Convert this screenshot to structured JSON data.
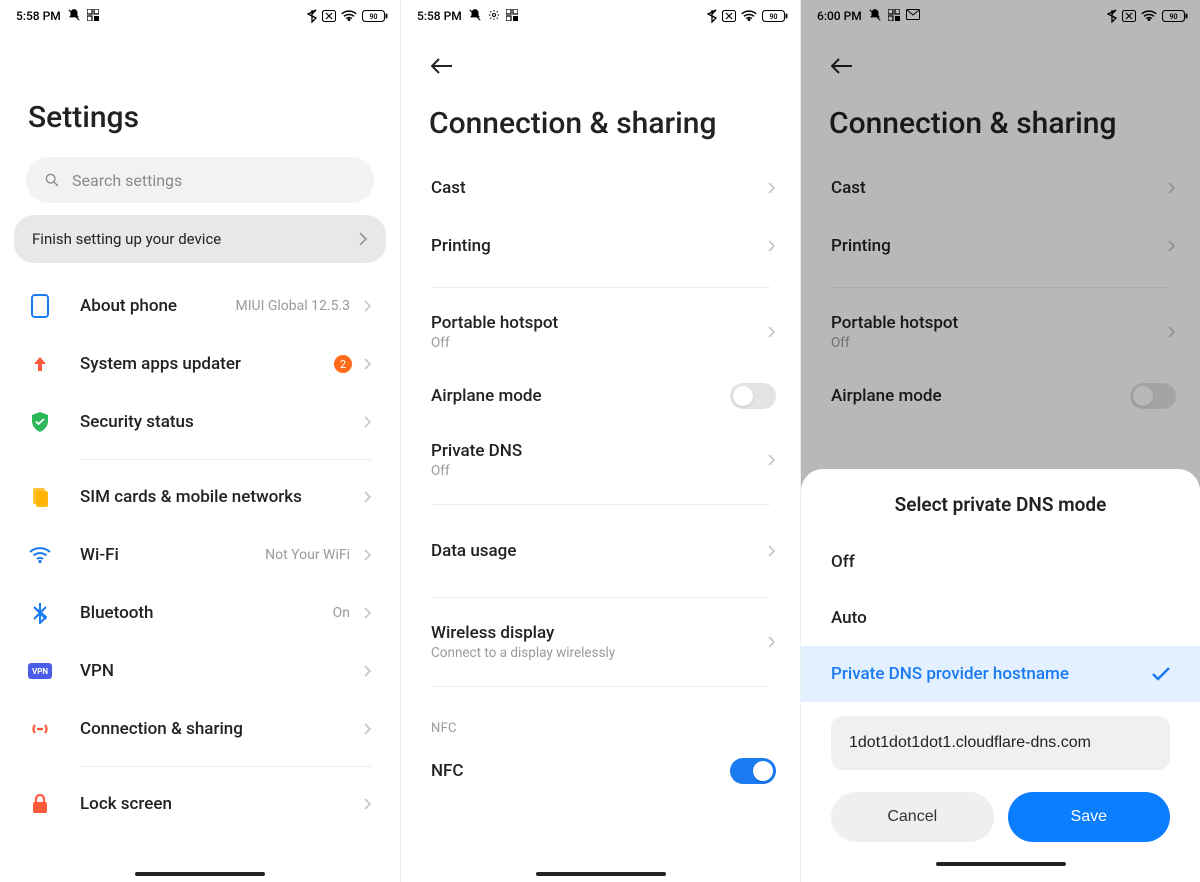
{
  "status": {
    "time1": "5:58 PM",
    "time2": "5:58 PM",
    "time3": "6:00 PM",
    "battery": "90"
  },
  "screen1": {
    "title": "Settings",
    "search_placeholder": "Search settings",
    "finish": "Finish setting up your device",
    "items": {
      "about": {
        "label": "About phone",
        "value": "MIUI Global 12.5.3"
      },
      "updater": {
        "label": "System apps updater",
        "badge": "2"
      },
      "security": {
        "label": "Security status"
      },
      "sim": {
        "label": "SIM cards & mobile networks"
      },
      "wifi": {
        "label": "Wi-Fi",
        "value": "Not Your WiFi"
      },
      "bt": {
        "label": "Bluetooth",
        "value": "On"
      },
      "vpn": {
        "label": "VPN"
      },
      "conn": {
        "label": "Connection & sharing"
      },
      "lock": {
        "label": "Lock screen"
      }
    }
  },
  "screen2": {
    "title": "Connection & sharing",
    "items": {
      "cast": {
        "label": "Cast"
      },
      "printing": {
        "label": "Printing"
      },
      "hotspot": {
        "label": "Portable hotspot",
        "sub": "Off"
      },
      "airplane": {
        "label": "Airplane mode"
      },
      "dns": {
        "label": "Private DNS",
        "sub": "Off"
      },
      "data": {
        "label": "Data usage"
      },
      "wireless": {
        "label": "Wireless display",
        "sub": "Connect to a display wirelessly"
      },
      "nfc_header": "NFC",
      "nfc": {
        "label": "NFC"
      }
    }
  },
  "sheet": {
    "title": "Select private DNS mode",
    "options": {
      "off": "Off",
      "auto": "Auto",
      "hostname": "Private DNS provider hostname"
    },
    "input_value": "1dot1dot1dot1.cloudflare-dns.com",
    "cancel": "Cancel",
    "save": "Save"
  }
}
